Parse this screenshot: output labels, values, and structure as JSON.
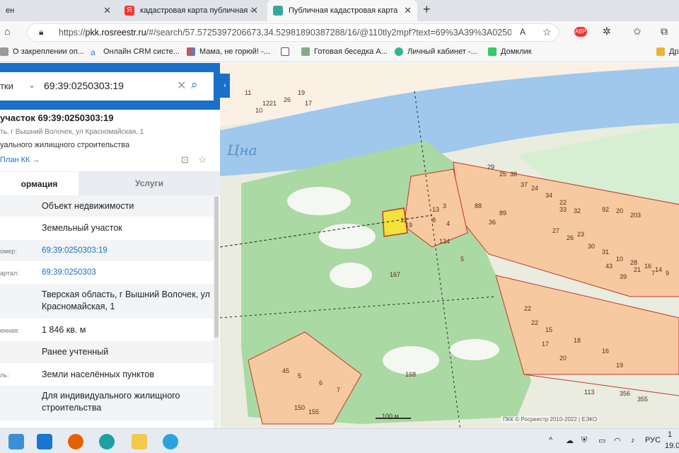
{
  "tabs": [
    {
      "label": "ен"
    },
    {
      "label": "кадастровая карта публичная -"
    },
    {
      "label": "Публичная кадастровая карта"
    }
  ],
  "address": {
    "url_prefix": "https://",
    "url_host": "pkk.rosreestr.ru",
    "url_rest": "/#/search/57.5725397206673,34.52981890387288/16/@110tly2mpf?text=69%3A39%3A0250..."
  },
  "bookmarks": [
    {
      "label": "О закреплении оп..."
    },
    {
      "label": "Онлайн CRM систе..."
    },
    {
      "label": "Мама, не горюй! -..."
    },
    {
      "label": ""
    },
    {
      "label": "Готовая беседка А..."
    },
    {
      "label": "Личный кабинет -..."
    },
    {
      "label": "Домклик"
    },
    {
      "label": "Др"
    }
  ],
  "search": {
    "category": "тки",
    "query": "69:39:0250303:19"
  },
  "object": {
    "title": "участок 69:39:0250303:19",
    "address": "ть, г Вышний Волочек, ул Красномайская, 1",
    "use": "уального жилищного строительства",
    "plan_link": "План КК →"
  },
  "panel_tabs": {
    "info": "ормация",
    "services": "Услуги"
  },
  "rows": [
    {
      "label": "",
      "value": "Объект недвижимости"
    },
    {
      "label": "",
      "value": "Земельный участок"
    },
    {
      "label": "омер:",
      "value": "69:39:0250303:19"
    },
    {
      "label": "артал:",
      "value": "69:39:0250303"
    },
    {
      "label": "",
      "value": "Тверская область, г Вышний Волочек, ул Красномайская, 1"
    },
    {
      "label": "енная:",
      "value": "1 846 кв. м"
    },
    {
      "label": "",
      "value": "Ранее учтенный"
    },
    {
      "label": "ль:",
      "value": "Земли населённых пунктов"
    },
    {
      "label": "",
      "value": "Для индивидуального жилищного строительства"
    }
  ],
  "map": {
    "river_label": "Цна",
    "scale_label": "100 м",
    "copyright": "ПКК © Росреестр 2010-2022 | ЕЭКО",
    "labels": [
      "11",
      "12",
      "10",
      "21",
      "26",
      "19",
      "17",
      "29",
      "25",
      "38",
      "37",
      "24",
      "34",
      "22",
      "13",
      "3",
      "12",
      "8",
      "4",
      "134",
      "5",
      "19",
      "88",
      "89",
      "36",
      "33",
      "32",
      "92",
      "20",
      "203",
      "27",
      "26",
      "23",
      "30",
      "31",
      "10",
      "28",
      "16",
      "14",
      "9",
      "43",
      "39",
      "21",
      "7",
      "167",
      "168",
      "45",
      "5",
      "6",
      "7",
      "150",
      "155",
      "113",
      "356",
      "355",
      "22",
      "15",
      "18",
      "16",
      "19",
      "20",
      "17",
      "22"
    ]
  },
  "tray": {
    "lang": "РУС",
    "time": "1",
    "date": "19.0"
  }
}
